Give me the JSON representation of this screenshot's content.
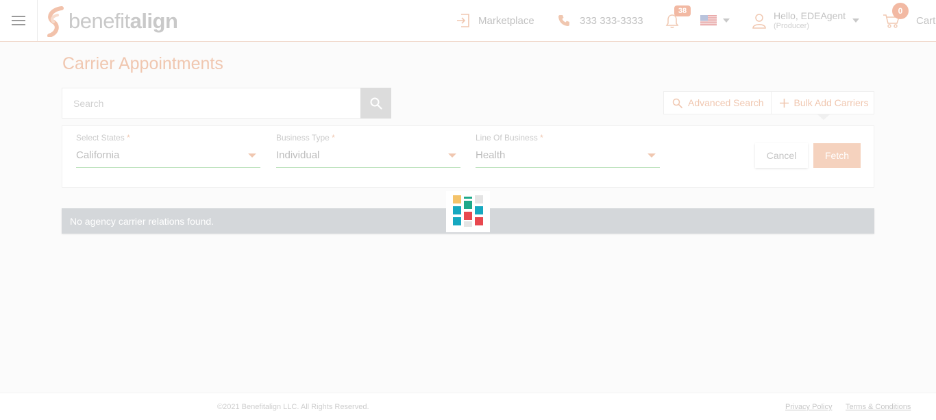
{
  "header": {
    "logo_prefix": "benefit",
    "logo_suffix": "align",
    "marketplace_label": "Marketplace",
    "phone": "333 333-3333",
    "notification_count": "38",
    "user_greeting": "Hello, EDEAgent",
    "user_role": "(Producer)",
    "cart_count": "0",
    "cart_label": "Cart"
  },
  "page": {
    "title": "Carrier Appointments"
  },
  "search": {
    "placeholder": "Search"
  },
  "actions": {
    "advanced_search": "Advanced Search",
    "bulk_add": "Bulk Add Carriers"
  },
  "filters": {
    "states_label": "Select States",
    "states_value": "California",
    "business_label": "Business Type",
    "business_value": "Individual",
    "line_label": "Line Of Business",
    "line_value": "Health",
    "required_marker": "*",
    "cancel_label": "Cancel",
    "fetch_label": "Fetch"
  },
  "results": {
    "empty_message": "No agency carrier relations found."
  },
  "footer": {
    "copyright": "©2021 Benefitalign LLC. All Rights Reserved.",
    "privacy": "Privacy Policy",
    "terms": "Terms & Conditions"
  },
  "colors": {
    "accent": "#f0c7b0",
    "loader_yellow": "#f4c36a",
    "loader_teal": "#16a8c0",
    "loader_green": "#1ea98a",
    "loader_red": "#e8484f",
    "loader_gray": "#e4e4e4"
  }
}
